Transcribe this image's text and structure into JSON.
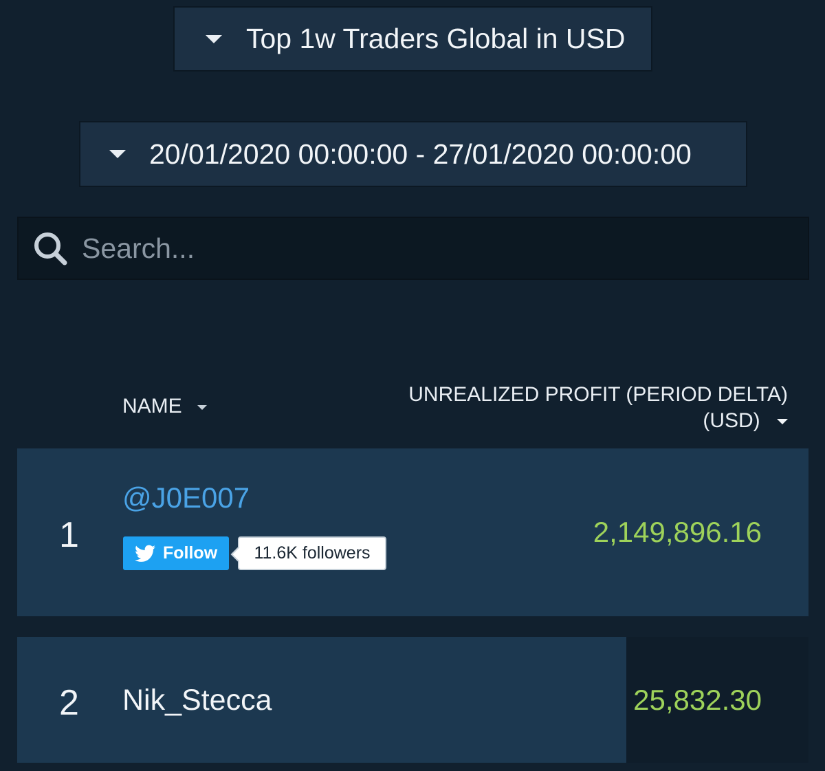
{
  "header": {
    "period_dropdown": {
      "label": "Top 1w Traders Global in USD"
    },
    "range_dropdown": {
      "label": "20/01/2020 00:00:00 - 27/01/2020 00:00:00"
    }
  },
  "search": {
    "placeholder": "Search..."
  },
  "table": {
    "columns": {
      "name": "NAME",
      "profit_line1": "UNREALIZED PROFIT (PERIOD DELTA)",
      "profit_line2": "(USD)"
    },
    "rows": [
      {
        "rank": "1",
        "name": "@J0E007",
        "follow_label": "Follow",
        "followers": "11.6K followers",
        "profit": "2,149,896.16"
      },
      {
        "rank": "2",
        "name": "Nik_Stecca",
        "profit": "25,832.30"
      }
    ]
  },
  "colors": {
    "background": "#11202e",
    "row_background": "#1c3850",
    "profit_positive": "#9ed25a",
    "twitter_blue": "#1da1f2",
    "handle_link": "#4aa3e6"
  },
  "icons": [
    "caret-down-icon",
    "search-icon",
    "twitter-bird-icon"
  ]
}
